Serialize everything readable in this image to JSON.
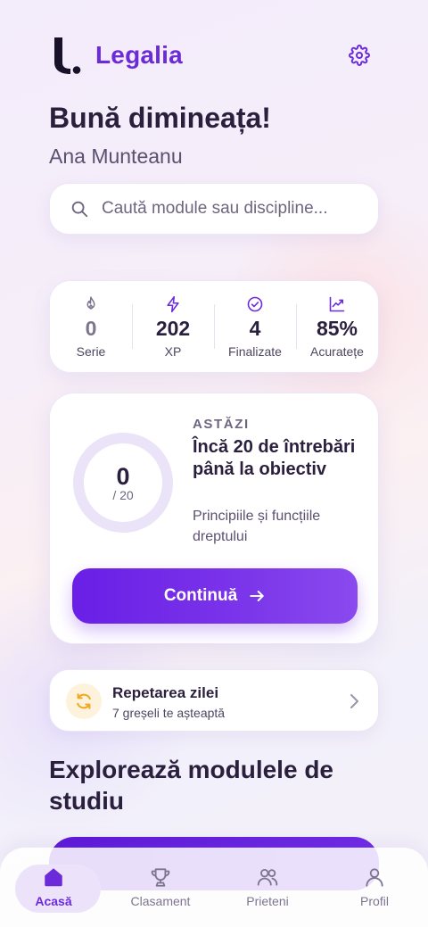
{
  "app": {
    "name": "Legalia"
  },
  "greeting": {
    "title": "Bună dimineața!",
    "user": "Ana Munteanu"
  },
  "search": {
    "placeholder": "Caută module sau discipline...",
    "value": ""
  },
  "stats": [
    {
      "icon": "flame-icon",
      "value": "0",
      "label": "Serie"
    },
    {
      "icon": "lightning-icon",
      "value": "202",
      "label": "XP"
    },
    {
      "icon": "check-circle-icon",
      "value": "4",
      "label": "Finalizate"
    },
    {
      "icon": "trend-chart-icon",
      "value": "85%",
      "label": "Acuratețe"
    }
  ],
  "goal": {
    "eyebrow": "ASTĂZI",
    "count": "0",
    "total": "/ 20",
    "progress": 0,
    "title": "Încă 20 de întrebări până la obiectiv",
    "subtitle": "Principiile și funcțiile dreptului",
    "button": "Continuă"
  },
  "review": {
    "title": "Repetarea zilei",
    "subtitle": "7 greșeli te așteaptă",
    "icon": "refresh-icon"
  },
  "section": {
    "title": "Explorează modulele de studiu"
  },
  "tabs": [
    {
      "label": "Acasă",
      "icon": "home-icon",
      "active": true
    },
    {
      "label": "Clasament",
      "icon": "trophy-icon",
      "active": false
    },
    {
      "label": "Prieteni",
      "icon": "users-icon",
      "active": false
    },
    {
      "label": "Profil",
      "icon": "user-icon",
      "active": false
    }
  ],
  "colors": {
    "accent": "#6c2bd9",
    "button": "#6a1fe6",
    "ring_track": "#ebe3f8",
    "review_icon": "#f0a820"
  }
}
